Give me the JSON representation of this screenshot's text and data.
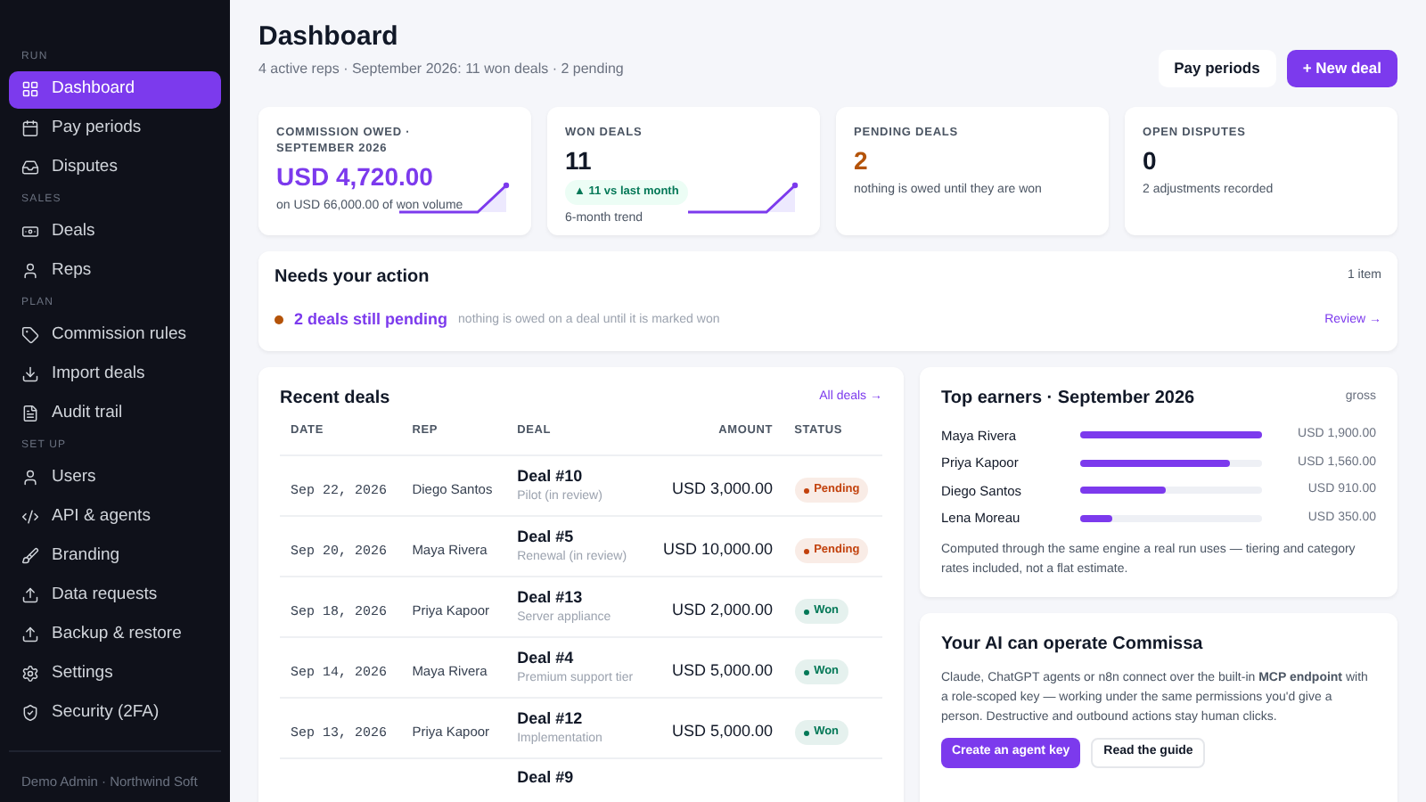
{
  "sidebar": {
    "sections": [
      {
        "label": "RUN",
        "items": [
          {
            "label": "Dashboard",
            "selected": true
          },
          {
            "label": "Pay periods",
            "selected": false
          },
          {
            "label": "Disputes",
            "selected": false
          }
        ]
      },
      {
        "label": "SALES",
        "items": [
          {
            "label": "Deals",
            "selected": false
          },
          {
            "label": "Reps",
            "selected": false
          }
        ]
      },
      {
        "label": "PLAN",
        "items": [
          {
            "label": "Commission rules",
            "selected": false
          },
          {
            "label": "Import deals",
            "selected": false
          },
          {
            "label": "Audit trail",
            "selected": false
          }
        ]
      },
      {
        "label": "SET UP",
        "items": [
          {
            "label": "Users",
            "selected": false
          },
          {
            "label": "API & agents",
            "selected": false
          },
          {
            "label": "Branding",
            "selected": false
          },
          {
            "label": "Data requests",
            "selected": false
          },
          {
            "label": "Backup & restore",
            "selected": false
          },
          {
            "label": "Settings",
            "selected": false
          },
          {
            "label": "Security (2FA)",
            "selected": false
          }
        ]
      }
    ],
    "footer": "Demo Admin · Northwind Soft"
  },
  "header": {
    "title": "Dashboard",
    "subtitle": "4 active reps · September 2026: 11 won deals · 2 pending",
    "buttons": [
      {
        "label": "Pay periods",
        "kind": "secondary"
      },
      {
        "label": "+ New deal",
        "kind": "primary"
      }
    ]
  },
  "stats": [
    {
      "label": "COMMISSION OWED · SEPTEMBER 2026",
      "value": "USD 4,720.00",
      "color": "#7c3aed",
      "note": "on USD 66,000.00 of won volume",
      "sparkline": true
    },
    {
      "label": "WON DEALS",
      "value": "11",
      "color": "#111827",
      "badge": "▲ 11 vs last month",
      "note": "6-month trend",
      "sparkline": true
    },
    {
      "label": "PENDING DEALS",
      "value": "2",
      "color": "#b45309",
      "note": "nothing is owed until they are won",
      "sparkline": false
    },
    {
      "label": "OPEN DISPUTES",
      "value": "0",
      "color": "#111827",
      "note": "2 adjustments recorded",
      "sparkline": false
    }
  ],
  "action_panel": {
    "title": "Needs your action",
    "count": "1 item",
    "items": [
      {
        "title": "2 deals still pending",
        "detail": "nothing is owed on a deal until it is marked won",
        "link": "Review →",
        "color": "#b45309"
      }
    ]
  },
  "recent_deals": {
    "title": "Recent deals",
    "link": "All deals →",
    "columns": [
      "DATE",
      "REP",
      "DEAL",
      "AMOUNT",
      "STATUS"
    ],
    "rows": [
      {
        "date": "Sep 22, 2026",
        "rep": "Diego Santos",
        "deal": "Deal #10",
        "detail": "Pilot (in review)",
        "amount": "USD 3,000.00",
        "status": "Pending",
        "color": "#c2410c"
      },
      {
        "date": "Sep 20, 2026",
        "rep": "Maya Rivera",
        "deal": "Deal #5",
        "detail": "Renewal (in review)",
        "amount": "USD 10,000.00",
        "status": "Pending",
        "color": "#c2410c"
      },
      {
        "date": "Sep 18, 2026",
        "rep": "Priya Kapoor",
        "deal": "Deal #13",
        "detail": "Server appliance",
        "amount": "USD 2,000.00",
        "status": "Won",
        "color": "#047857"
      },
      {
        "date": "Sep 14, 2026",
        "rep": "Maya Rivera",
        "deal": "Deal #4",
        "detail": "Premium support tier",
        "amount": "USD 5,000.00",
        "status": "Won",
        "color": "#047857"
      },
      {
        "date": "Sep 13, 2026",
        "rep": "Priya Kapoor",
        "deal": "Deal #12",
        "detail": "Implementation",
        "amount": "USD 5,000.00",
        "status": "Won",
        "color": "#047857"
      },
      {
        "deal": "Deal #9"
      }
    ]
  },
  "top_earners": {
    "title": "Top earners · September 2026",
    "tag": "gross",
    "rows": [
      {
        "name": "Maya Rivera",
        "level": 1.0,
        "amount": "USD 1,900.00"
      },
      {
        "name": "Priya Kapoor",
        "level": 0.82,
        "amount": "USD 1,560.00"
      },
      {
        "name": "Diego Santos",
        "level": 0.47,
        "amount": "USD 910.00"
      },
      {
        "name": "Lena Moreau",
        "level": 0.18,
        "amount": "USD 350.00"
      }
    ],
    "note": "Computed through the same engine a real run uses — tiering and category rates included, not a flat estimate."
  },
  "ai_card": {
    "title": "Your AI can operate Commissa",
    "text": "Claude, ChatGPT agents or n8n connect over the built-in **MCP endpoint** with a role-scoped key — working under the same permissions you'd give a person. Destructive and outbound actions stay human clicks.",
    "buttons": [
      {
        "label": "Create an agent key",
        "kind": "primary"
      },
      {
        "label": "Read the guide",
        "kind": "secondary"
      }
    ]
  }
}
